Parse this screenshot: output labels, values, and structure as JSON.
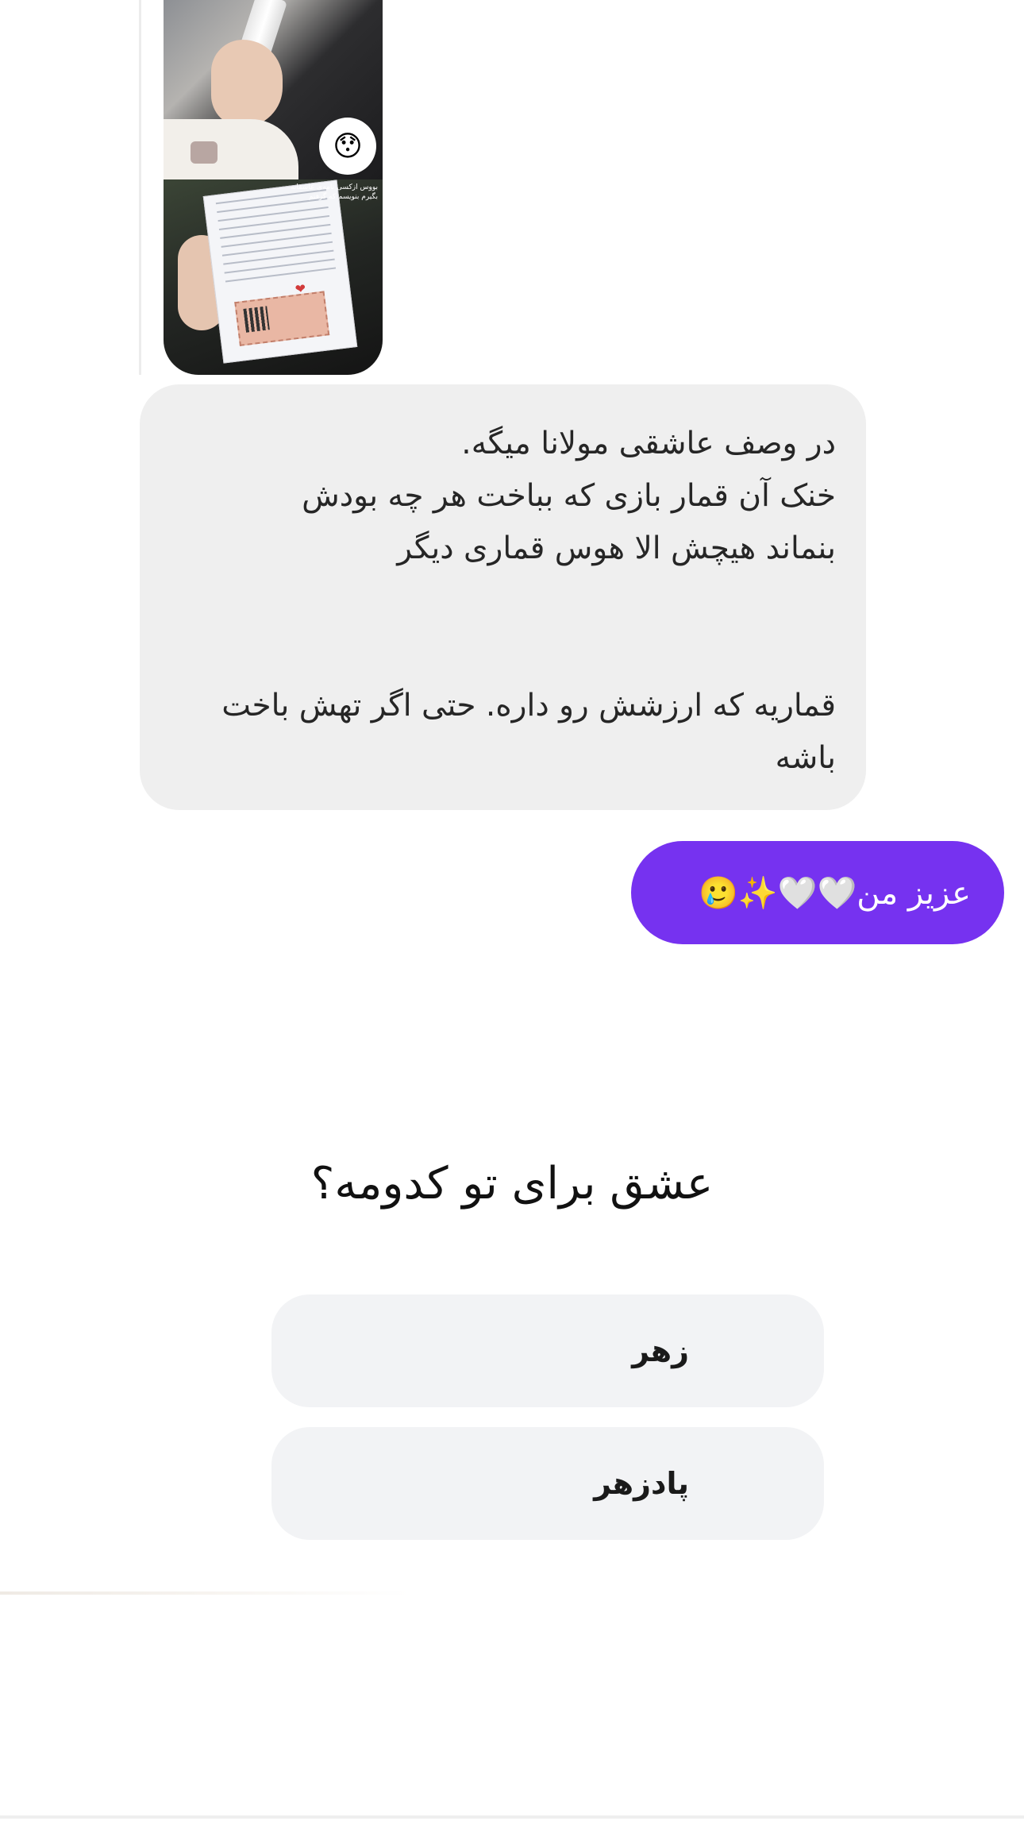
{
  "shared_post": {
    "caption": "بووس ازکسی نامه‌ی عاشقانه بگیرم بنویسم که گرفتم",
    "reaction_emoji": "😯"
  },
  "received_message": {
    "text": "در وصف عاشقی مولانا میگه.\nخنک آن قمار بازی که بباخت هر چه بودش\nبنماند هیچش الا هوس قماری دیگر\n\n\nقماریه که ارزشش رو داره. حتی اگر تهش باخت باشه"
  },
  "sent_message": {
    "text": "عزیز من🤍🤍✨🥲"
  },
  "poll": {
    "question": "عشق برای تو کدومه؟",
    "options": [
      "زهر",
      "پادزهر"
    ]
  },
  "colors": {
    "sent_bubble": "#7632f0",
    "received_bubble": "#efefef",
    "poll_option_bg": "#f2f3f5"
  }
}
